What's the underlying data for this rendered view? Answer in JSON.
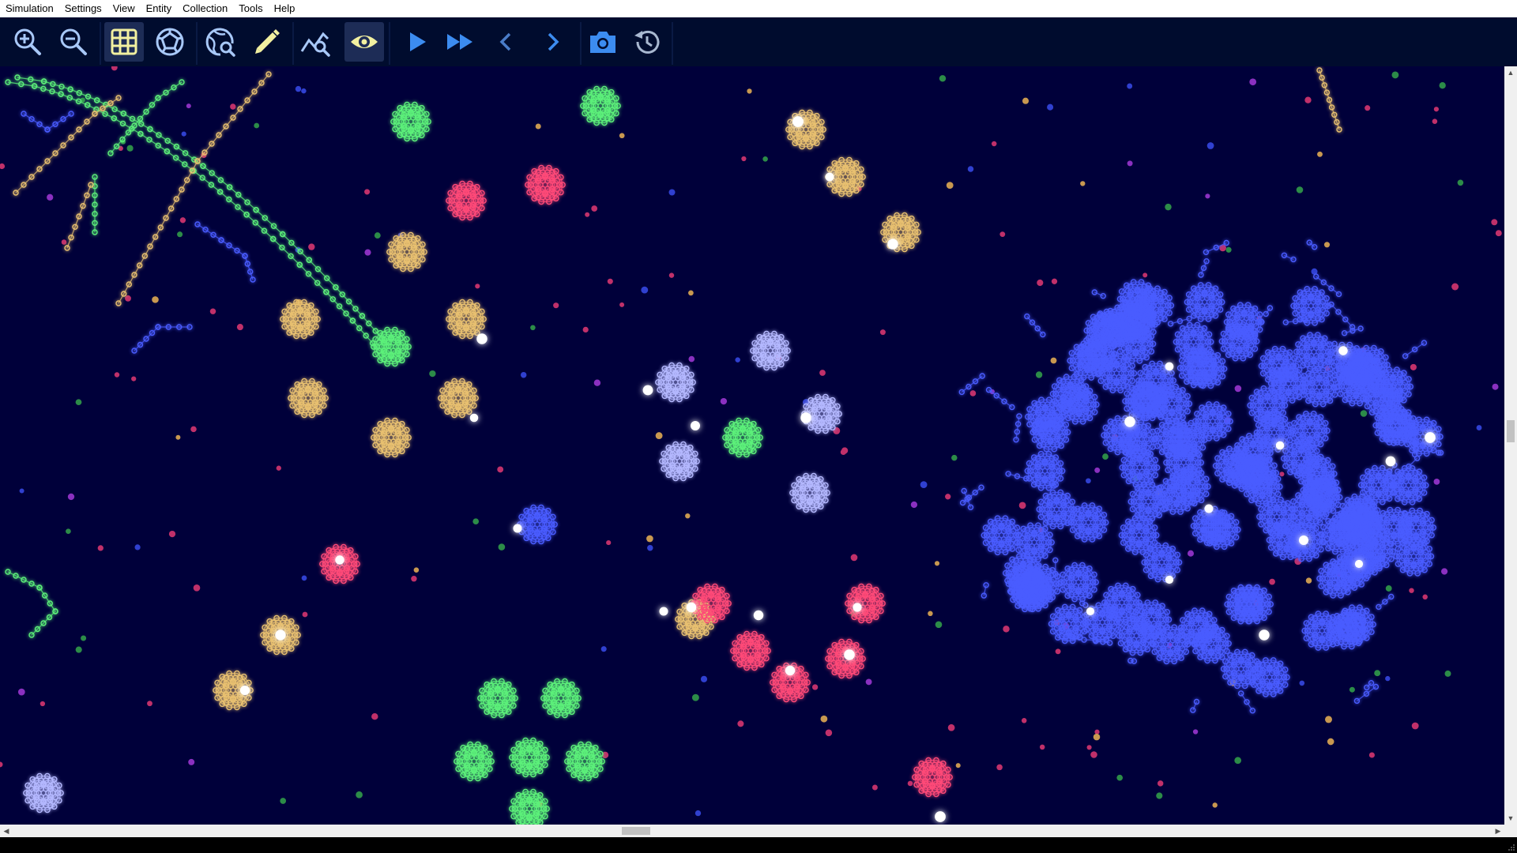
{
  "menubar": {
    "items": [
      "Simulation",
      "Settings",
      "View",
      "Entity",
      "Collection",
      "Tools",
      "Help"
    ]
  },
  "toolbar": {
    "buttons": [
      {
        "icon": "zoom-in-icon",
        "active": false
      },
      {
        "icon": "zoom-out-icon",
        "active": false
      },
      {
        "icon": "grid-icon",
        "active": true
      },
      {
        "icon": "radial-monitor-icon",
        "active": false
      },
      {
        "icon": "global-search-icon",
        "active": false
      },
      {
        "icon": "pencil-icon",
        "active": false
      },
      {
        "icon": "chart-search-icon",
        "active": false
      },
      {
        "icon": "eye-icon",
        "active": true
      },
      {
        "icon": "play-icon",
        "active": false
      },
      {
        "icon": "fast-forward-icon",
        "active": false
      },
      {
        "icon": "step-back-icon",
        "active": false
      },
      {
        "icon": "step-forward-icon",
        "active": false
      },
      {
        "icon": "camera-icon",
        "active": false
      },
      {
        "icon": "restore-icon",
        "active": false
      }
    ]
  },
  "scrollbars": {
    "horizontal_position": 0.42,
    "vertical_position": 0.48
  },
  "colors": {
    "background": "#00003a",
    "toolbar": "#000c2e",
    "green": "#5cf07a",
    "gold": "#e8c070",
    "lavender": "#b4b8ff",
    "blue": "#4a5cff",
    "red": "#ff4a78",
    "icon_yellow": "#f2f0a0",
    "icon_light": "#a8c8f8",
    "icon_blue": "#3c8cf0"
  }
}
